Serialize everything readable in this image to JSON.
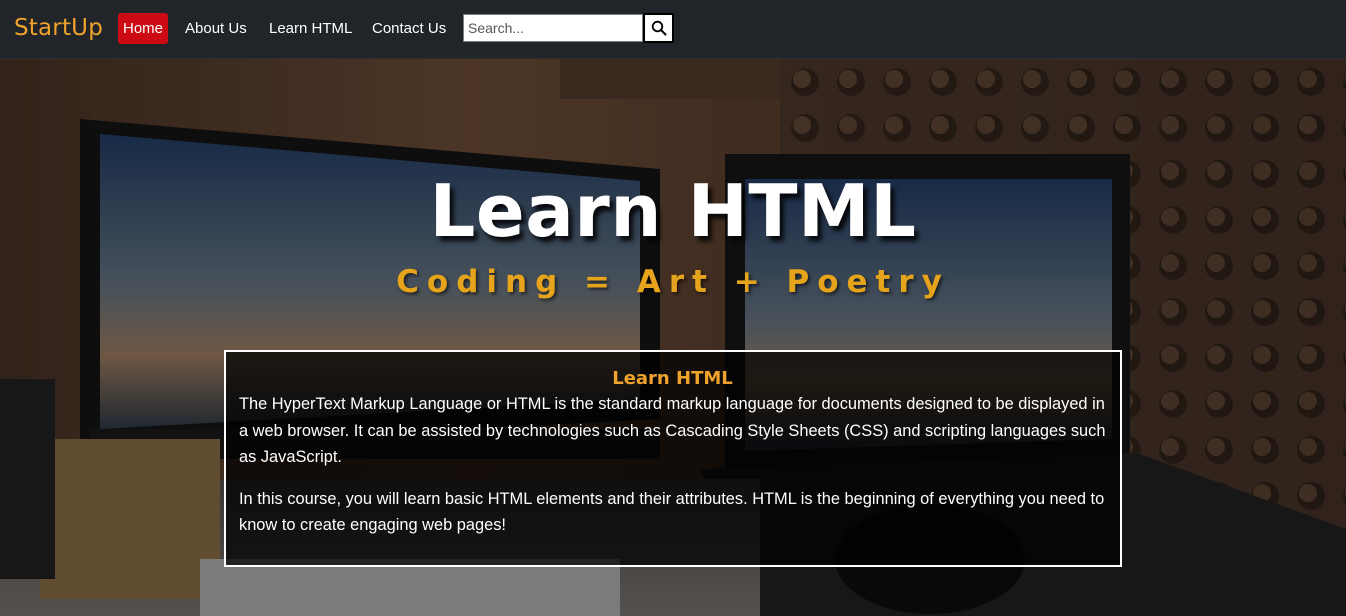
{
  "navbar": {
    "brand": "StartUp",
    "links": [
      "Home",
      "About Us",
      "Learn HTML",
      "Contact Us"
    ],
    "search_placeholder": "Search...",
    "search_icon": "search-icon"
  },
  "hero": {
    "title": "Learn HTML",
    "subtitle": "Coding = Art + Poetry",
    "box_title": "Learn HTML",
    "paragraphs": [
      "The HyperText Markup Language or HTML is the standard markup language for documents designed to be displayed in a web browser. It can be assisted by technologies such as Cascading Style Sheets (CSS) and scripting languages such as JavaScript.",
      "In this course, you will learn basic HTML elements and their attributes. HTML is the beginning of everything you need to know to create engaging web pages!"
    ]
  },
  "colors": {
    "brand": "#f0a32c",
    "active_link": "#cc0a14",
    "navbar_bg": "#212428",
    "subtitle": "#e5a41c"
  }
}
